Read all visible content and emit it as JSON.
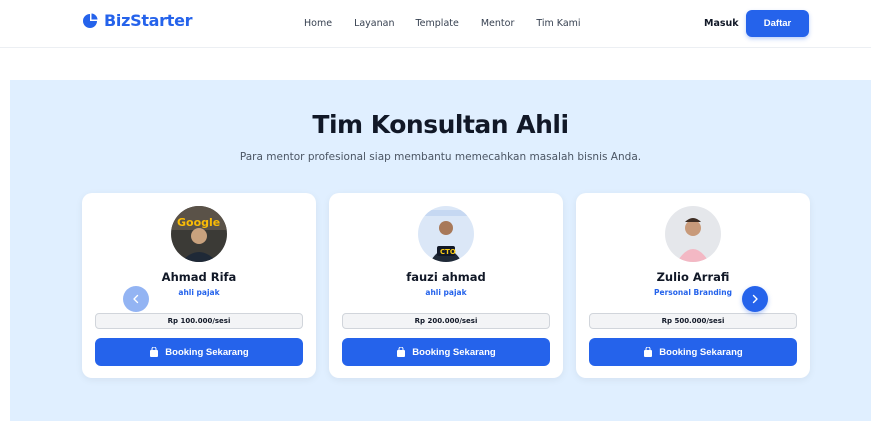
{
  "navbar": {
    "brand": "BizStarter",
    "links": [
      "Home",
      "Layanan",
      "Template",
      "Mentor",
      "Tim Kami"
    ],
    "login_label": "Masuk",
    "register_label": "Daftar"
  },
  "section": {
    "title": "Tim Konsultan Ahli",
    "subtitle": "Para mentor profesional siap membantu memecahkan masalah bisnis Anda."
  },
  "mentors": [
    {
      "name": "Ahmad Rifa",
      "role": "ahli pajak",
      "price": "Rp 100.000/sesi",
      "button": "Booking Sekarang"
    },
    {
      "name": "fauzi ahmad",
      "role": "ahli pajak",
      "price": "Rp 200.000/sesi",
      "button": "Booking Sekarang"
    },
    {
      "name": "Zulio Arrafi",
      "role": "Personal Branding",
      "price": "Rp 500.000/sesi",
      "button": "Booking Sekarang"
    }
  ],
  "avatar_labels": {
    "google_sign": "Google",
    "cto_badge": "CTO"
  },
  "colors": {
    "primary": "#2563eb",
    "section_bg": "#e0efff",
    "arrow_prev": "#93b4f3"
  },
  "icons": {
    "brand": "pie-chart-icon",
    "prev": "chevron-left-icon",
    "next": "chevron-right-icon",
    "booking": "shopping-bag-icon"
  }
}
